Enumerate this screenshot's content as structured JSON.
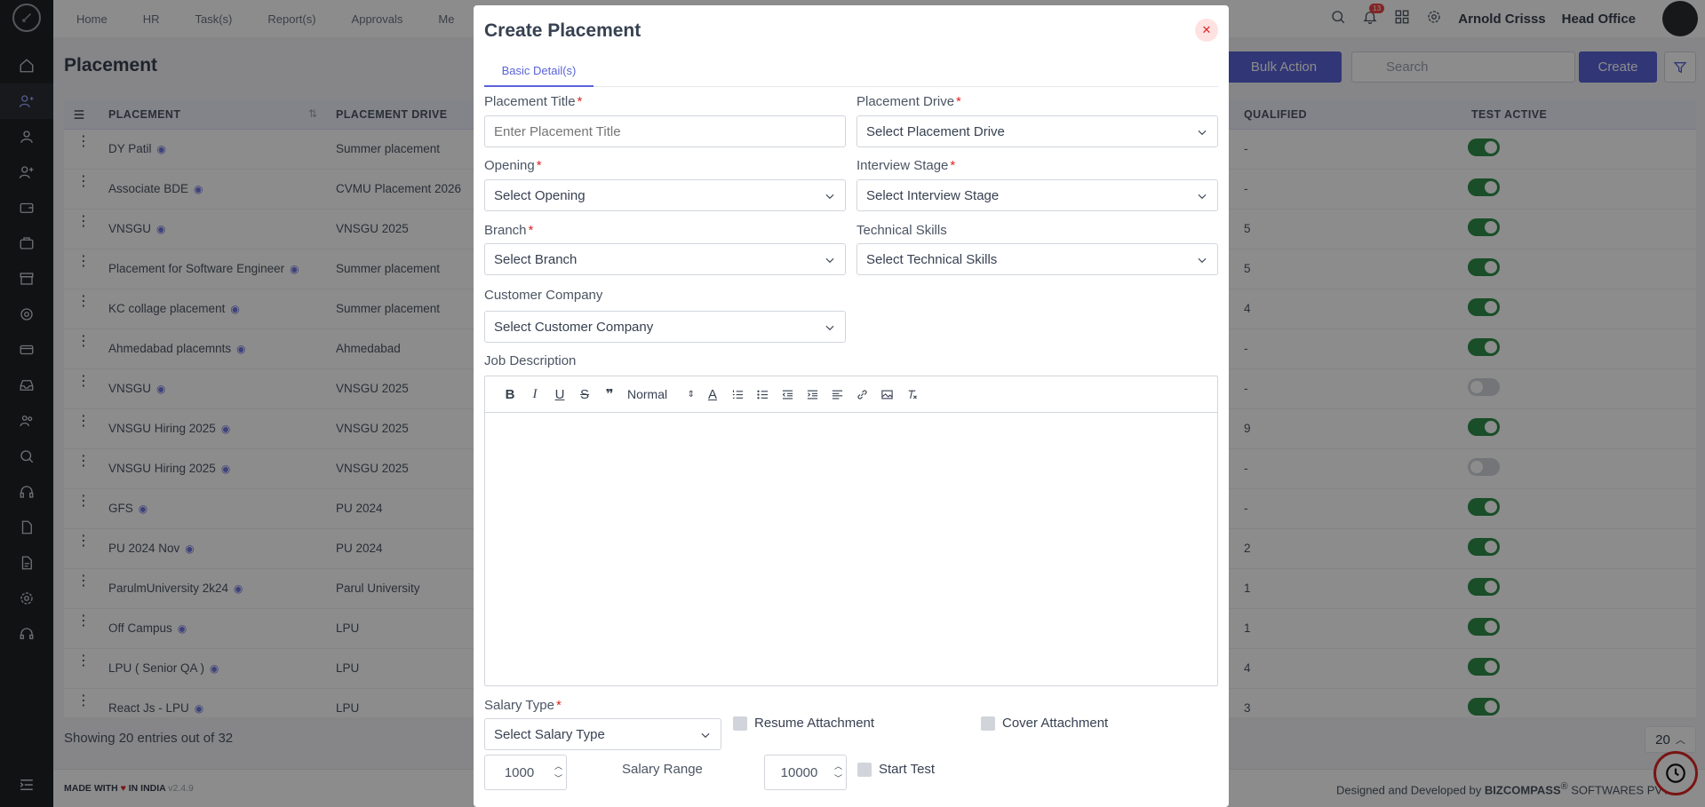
{
  "topbar": {
    "nav": [
      "Home",
      "HR",
      "Task(s)",
      "Report(s)",
      "Approvals",
      "Me"
    ],
    "notification_count": "13",
    "user_name": "Arnold Crisss",
    "office": "Head Office"
  },
  "page": {
    "title": "Placement",
    "bulk_action": "Bulk Action",
    "search_placeholder": "Search",
    "create": "Create"
  },
  "table": {
    "headers": {
      "placement": "PLACEMENT",
      "drive": "PLACEMENT DRIVE",
      "qualified": "QUALIFIED",
      "test_active": "TEST ACTIVE"
    },
    "rows": [
      {
        "placement": "DY Patil",
        "drive": "Summer placement",
        "qualified": "-",
        "active": true
      },
      {
        "placement": "Associate BDE",
        "drive": "CVMU Placement 2026",
        "qualified": "-",
        "active": true
      },
      {
        "placement": "VNSGU",
        "drive": "VNSGU 2025",
        "qualified": "5",
        "active": true
      },
      {
        "placement": "Placement for Software Engineer",
        "drive": "Summer placement",
        "qualified": "5",
        "active": true
      },
      {
        "placement": "KC collage placement",
        "drive": "Summer placement",
        "qualified": "4",
        "active": true
      },
      {
        "placement": "Ahmedabad placemnts",
        "drive": "Ahmedabad",
        "qualified": "-",
        "active": true
      },
      {
        "placement": "VNSGU",
        "drive": "VNSGU 2025",
        "qualified": "-",
        "active": false
      },
      {
        "placement": "VNSGU Hiring 2025",
        "drive": "VNSGU 2025",
        "qualified": "9",
        "active": true
      },
      {
        "placement": "VNSGU Hiring 2025",
        "drive": "VNSGU 2025",
        "qualified": "-",
        "active": false
      },
      {
        "placement": "GFS",
        "drive": "PU 2024",
        "qualified": "-",
        "active": true
      },
      {
        "placement": "PU 2024 Nov",
        "drive": "PU 2024",
        "qualified": "2",
        "active": true
      },
      {
        "placement": "ParulmUniversity 2k24",
        "drive": "Parul University",
        "qualified": "1",
        "active": true
      },
      {
        "placement": "Off Campus",
        "drive": "LPU",
        "qualified": "1",
        "active": true
      },
      {
        "placement": "LPU ( Senior QA )",
        "drive": "LPU",
        "qualified": "4",
        "active": true
      },
      {
        "placement": "React Js - LPU",
        "drive": "LPU",
        "qualified": "3",
        "active": true
      }
    ],
    "showing": "Showing 20 entries out of 32",
    "page_size": "20"
  },
  "footer": {
    "made_with": "MADE WITH",
    "in_india": "IN INDIA",
    "version": "v2.4.9",
    "designed_by": "Designed and Developed by",
    "company": "BIZCOMPASS",
    "company_suffix": "SOFTWARES PVT"
  },
  "modal": {
    "title": "Create Placement",
    "tab": "Basic Detail(s)",
    "fields": {
      "placement_title": {
        "label": "Placement Title",
        "placeholder": "Enter Placement Title"
      },
      "placement_drive": {
        "label": "Placement Drive",
        "value": "Select Placement Drive"
      },
      "opening": {
        "label": "Opening",
        "value": "Select Opening"
      },
      "interview_stage": {
        "label": "Interview Stage",
        "value": "Select Interview Stage"
      },
      "branch": {
        "label": "Branch",
        "value": "Select Branch"
      },
      "technical_skills": {
        "label": "Technical Skills",
        "value": "Select Technical Skills"
      },
      "customer_company": {
        "label": "Customer Company",
        "value": "Select Customer Company"
      },
      "job_description": {
        "label": "Job Description"
      },
      "salary_type": {
        "label": "Salary Type",
        "value": "Select Salary Type"
      },
      "salary_range": {
        "label": "Salary Range",
        "min": "1000",
        "max": "10000"
      }
    },
    "editor_format": "Normal",
    "checkboxes": {
      "resume": "Resume Attachment",
      "cover": "Cover Attachment",
      "start_test": "Start Test"
    }
  }
}
